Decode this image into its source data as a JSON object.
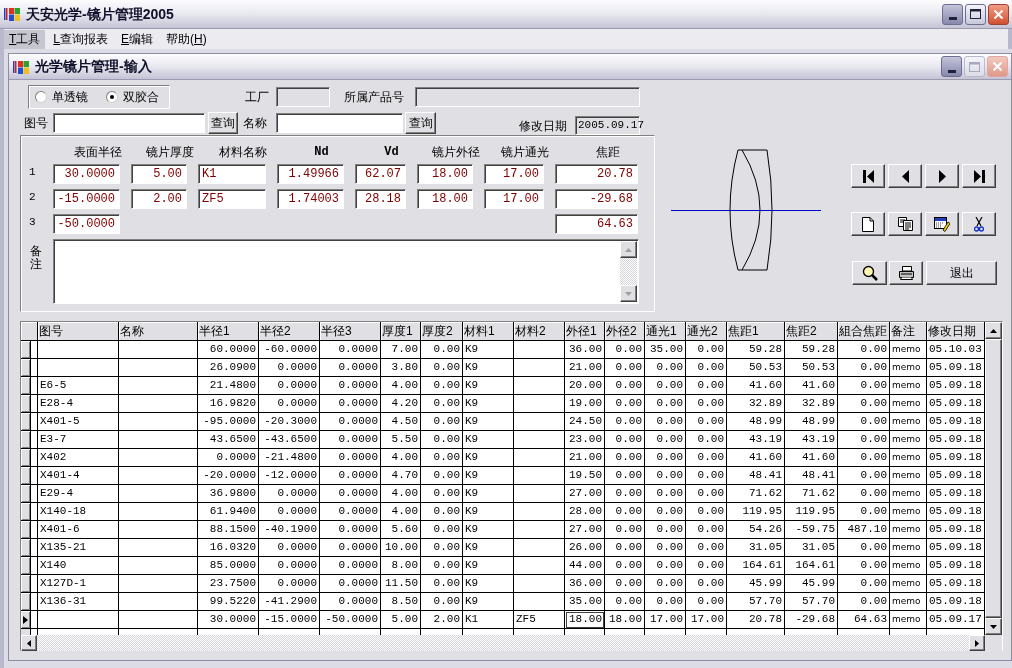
{
  "window": {
    "title": "天安光学-镜片管理2005"
  },
  "menu": [
    {
      "key": "T",
      "after": "工具",
      "selected": true
    },
    {
      "key": "L",
      "after": "查询报表",
      "selected": false
    },
    {
      "key": "E",
      "after": "编辑",
      "selected": false
    },
    {
      "before": "帮助(",
      "key": "H",
      "after": ")",
      "selected": false
    }
  ],
  "document": {
    "title": "光学镜片管理-输入",
    "lens_type": [
      {
        "label": "单透镜",
        "selected": false
      },
      {
        "label": "双胶合",
        "selected": true
      }
    ],
    "factory": {
      "label": "工厂",
      "disabled": true
    },
    "product_no": {
      "label": "所属产品号",
      "disabled": true
    },
    "drawing_no": {
      "label": "图号",
      "disabled": false,
      "button": "查询"
    },
    "name": {
      "label": "名称",
      "disabled": false,
      "button": "查询"
    },
    "modified_date": {
      "label": "修改日期",
      "value": "2005.09.17",
      "disabled": true
    },
    "surfaces": {
      "headers": [
        "表面半径",
        "镜片厚度",
        "材料名称",
        "Nd",
        "Vd",
        "镜片外径",
        "镜片通光",
        "焦距"
      ],
      "rows": [
        {
          "number": "1",
          "radius": "30.0000",
          "thickness": "5.00",
          "material": "K1",
          "nd": "1.49966",
          "vd": "62.07",
          "outer_diameter": "18.00",
          "clear_aperture": "17.00",
          "focal_length": "20.78"
        },
        {
          "number": "2",
          "radius": "-15.0000",
          "thickness": "2.00",
          "material": "ZF5",
          "nd": "1.74003",
          "vd": "28.18",
          "outer_diameter": "18.00",
          "clear_aperture": "17.00",
          "focal_length": "-29.68"
        },
        {
          "number": "3",
          "radius": "-50.0000",
          "focal_length": "64.63"
        }
      ]
    },
    "remarks": {
      "label": "备注"
    },
    "exit_button": {
      "label": "退出"
    },
    "table": {
      "columns": [
        {
          "label": "图号",
          "kind": "text",
          "focused": false
        },
        {
          "label": "名称",
          "kind": "text",
          "focused": false
        },
        {
          "label": "半径1",
          "kind": "number",
          "focused": false
        },
        {
          "label": "半径2",
          "kind": "number",
          "focused": false
        },
        {
          "label": "半径3",
          "kind": "number",
          "focused": false
        },
        {
          "label": "厚度1",
          "kind": "number",
          "focused": false
        },
        {
          "label": "厚度2",
          "kind": "number",
          "focused": false
        },
        {
          "label": "材料1",
          "kind": "text",
          "focused": false
        },
        {
          "label": "材料2",
          "kind": "text",
          "focused": false
        },
        {
          "label": "外径1",
          "kind": "number",
          "focused": true
        },
        {
          "label": "外径2",
          "kind": "number",
          "focused": false
        },
        {
          "label": "通光1",
          "kind": "number",
          "focused": false
        },
        {
          "label": "通光2",
          "kind": "number",
          "focused": false
        },
        {
          "label": "焦距1",
          "kind": "number",
          "focused": false
        },
        {
          "label": "焦距2",
          "kind": "number",
          "focused": false
        },
        {
          "label": "組合焦距",
          "kind": "number",
          "focused": false
        },
        {
          "label": "备注",
          "kind": "memo",
          "focused": false
        },
        {
          "label": "修改日期",
          "kind": "date",
          "focused": false
        }
      ],
      "rows": [
        {
          "selected": false,
          "cells": [
            null,
            null,
            "60.0000",
            "-60.0000",
            "0.0000",
            "7.00",
            "0.00",
            "K9",
            null,
            "36.00",
            "0.00",
            "35.00",
            "0.00",
            "59.28",
            "59.28",
            "0.00",
            "memo",
            "05.10.03"
          ]
        },
        {
          "selected": false,
          "cells": [
            null,
            null,
            "26.0900",
            "0.0000",
            "0.0000",
            "3.80",
            "0.00",
            "K9",
            null,
            "21.00",
            "0.00",
            "0.00",
            "0.00",
            "50.53",
            "50.53",
            "0.00",
            "memo",
            "05.09.18"
          ]
        },
        {
          "selected": false,
          "cells": [
            "E6-5",
            null,
            "21.4800",
            "0.0000",
            "0.0000",
            "4.00",
            "0.00",
            "K9",
            null,
            "20.00",
            "0.00",
            "0.00",
            "0.00",
            "41.60",
            "41.60",
            "0.00",
            "memo",
            "05.09.18"
          ]
        },
        {
          "selected": false,
          "cells": [
            "E28-4",
            null,
            "16.9820",
            "0.0000",
            "0.0000",
            "4.20",
            "0.00",
            "K9",
            null,
            "19.00",
            "0.00",
            "0.00",
            "0.00",
            "32.89",
            "32.89",
            "0.00",
            "memo",
            "05.09.18"
          ]
        },
        {
          "selected": false,
          "cells": [
            "X401-5",
            null,
            "-95.0000",
            "-20.3000",
            "0.0000",
            "4.50",
            "0.00",
            "K9",
            null,
            "24.50",
            "0.00",
            "0.00",
            "0.00",
            "48.99",
            "48.99",
            "0.00",
            "memo",
            "05.09.18"
          ]
        },
        {
          "selected": false,
          "cells": [
            "E3-7",
            null,
            "43.6500",
            "-43.6500",
            "0.0000",
            "5.50",
            "0.00",
            "K9",
            null,
            "23.00",
            "0.00",
            "0.00",
            "0.00",
            "43.19",
            "43.19",
            "0.00",
            "memo",
            "05.09.18"
          ]
        },
        {
          "selected": false,
          "cells": [
            "X402",
            null,
            "0.0000",
            "-21.4800",
            "0.0000",
            "4.00",
            "0.00",
            "K9",
            null,
            "21.00",
            "0.00",
            "0.00",
            "0.00",
            "41.60",
            "41.60",
            "0.00",
            "memo",
            "05.09.18"
          ]
        },
        {
          "selected": false,
          "cells": [
            "X401-4",
            null,
            "-20.0000",
            "-12.0000",
            "0.0000",
            "4.70",
            "0.00",
            "K9",
            null,
            "19.50",
            "0.00",
            "0.00",
            "0.00",
            "48.41",
            "48.41",
            "0.00",
            "memo",
            "05.09.18"
          ]
        },
        {
          "selected": false,
          "cells": [
            "E29-4",
            null,
            "36.9800",
            "0.0000",
            "0.0000",
            "4.00",
            "0.00",
            "K9",
            null,
            "27.00",
            "0.00",
            "0.00",
            "0.00",
            "71.62",
            "71.62",
            "0.00",
            "memo",
            "05.09.18"
          ]
        },
        {
          "selected": false,
          "cells": [
            "X140-18",
            null,
            "61.9400",
            "0.0000",
            "0.0000",
            "4.00",
            "0.00",
            "K9",
            null,
            "28.00",
            "0.00",
            "0.00",
            "0.00",
            "119.95",
            "119.95",
            "0.00",
            "memo",
            "05.09.18"
          ]
        },
        {
          "selected": false,
          "cells": [
            "X401-6",
            null,
            "88.1500",
            "-40.1900",
            "0.0000",
            "5.60",
            "0.00",
            "K9",
            null,
            "27.00",
            "0.00",
            "0.00",
            "0.00",
            "54.26",
            "-59.75",
            "487.10",
            "memo",
            "05.09.18"
          ]
        },
        {
          "selected": false,
          "cells": [
            "X135-21",
            null,
            "16.0320",
            "0.0000",
            "0.0000",
            "10.00",
            "0.00",
            "K9",
            null,
            "26.00",
            "0.00",
            "0.00",
            "0.00",
            "31.05",
            "31.05",
            "0.00",
            "memo",
            "05.09.18"
          ]
        },
        {
          "selected": false,
          "cells": [
            "X140",
            null,
            "85.0000",
            "0.0000",
            "0.0000",
            "8.00",
            "0.00",
            "K9",
            null,
            "44.00",
            "0.00",
            "0.00",
            "0.00",
            "164.61",
            "164.61",
            "0.00",
            "memo",
            "05.09.18"
          ]
        },
        {
          "selected": false,
          "cells": [
            "X127D-1",
            null,
            "23.7500",
            "0.0000",
            "0.0000",
            "11.50",
            "0.00",
            "K9",
            null,
            "36.00",
            "0.00",
            "0.00",
            "0.00",
            "45.99",
            "45.99",
            "0.00",
            "memo",
            "05.09.18"
          ]
        },
        {
          "selected": false,
          "cells": [
            "X136-31",
            null,
            "99.5220",
            "-41.2900",
            "0.0000",
            "8.50",
            "0.00",
            "K9",
            null,
            "35.00",
            "0.00",
            "0.00",
            "0.00",
            "57.70",
            "57.70",
            "0.00",
            "memo",
            "05.09.18"
          ]
        },
        {
          "selected": true,
          "cells": [
            null,
            null,
            "30.0000",
            "-15.0000",
            "-50.0000",
            "5.00",
            "2.00",
            "K1",
            "ZF5",
            "18.00",
            "18.00",
            "17.00",
            "17.00",
            "20.78",
            "-29.68",
            "64.63",
            "memo",
            "05.09.17"
          ]
        }
      ]
    }
  }
}
